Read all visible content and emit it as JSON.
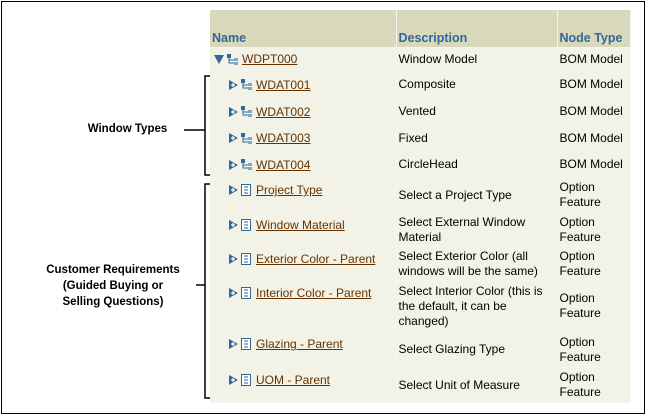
{
  "table": {
    "headers": {
      "name": "Name",
      "description": "Description",
      "node_type": "Node Type"
    },
    "rows": [
      {
        "name": "WDPT000",
        "description": "Window Model",
        "node_type": "BOM Model",
        "icon": "bom-model-icon",
        "expander": "collapse-triangle-icon",
        "indent": 0
      },
      {
        "name": "WDAT001",
        "description": "Composite",
        "node_type": "BOM Model",
        "icon": "bom-model-icon",
        "expander": "expand-triangle-icon",
        "indent": 1
      },
      {
        "name": "WDAT002",
        "description": "Vented",
        "node_type": "BOM Model",
        "icon": "bom-model-icon",
        "expander": "expand-triangle-icon",
        "indent": 1
      },
      {
        "name": "WDAT003",
        "description": "Fixed",
        "node_type": "BOM Model",
        "icon": "bom-model-icon",
        "expander": "expand-triangle-icon",
        "indent": 1
      },
      {
        "name": "WDAT004",
        "description": "CircleHead",
        "node_type": "BOM Model",
        "icon": "bom-model-icon",
        "expander": "expand-triangle-icon",
        "indent": 1
      },
      {
        "name": "Project Type",
        "description": "Select a Project Type",
        "node_type": "Option Feature",
        "icon": "option-feature-icon",
        "expander": "expand-triangle-icon",
        "indent": 1
      },
      {
        "name": "Window Material",
        "description": "Select External Window Material",
        "node_type": "Option Feature",
        "icon": "option-feature-icon",
        "expander": "expand-triangle-icon",
        "indent": 1
      },
      {
        "name": "Exterior Color - Parent",
        "description": "Select Exterior Color (all windows will be the same)",
        "node_type": "Option Feature",
        "icon": "option-feature-icon",
        "expander": "expand-triangle-icon",
        "indent": 1
      },
      {
        "name": "Interior Color - Parent",
        "description": "Select Interior Color (this is the default, it can be changed)",
        "node_type": "Option Feature",
        "icon": "option-feature-icon",
        "expander": "expand-triangle-icon",
        "indent": 1
      },
      {
        "name": "Glazing - Parent",
        "description": "Select Glazing Type",
        "node_type": "Option Feature",
        "icon": "option-feature-icon",
        "expander": "expand-triangle-icon",
        "indent": 1
      },
      {
        "name": "UOM - Parent",
        "description": "Select Unit of Measure",
        "node_type": "Option Feature",
        "icon": "option-feature-icon",
        "expander": "expand-triangle-icon",
        "indent": 1
      }
    ]
  },
  "annotations": {
    "window_types": "Window Types",
    "customer_requirements": [
      "Customer Requirements",
      "(Guided Buying or",
      "Selling Questions)"
    ]
  },
  "colors": {
    "header_bg": "#d8d8bc",
    "header_text": "#336699",
    "row_bg": "#f2f2e6",
    "link": "#663300",
    "icon_blue": "#336699"
  }
}
